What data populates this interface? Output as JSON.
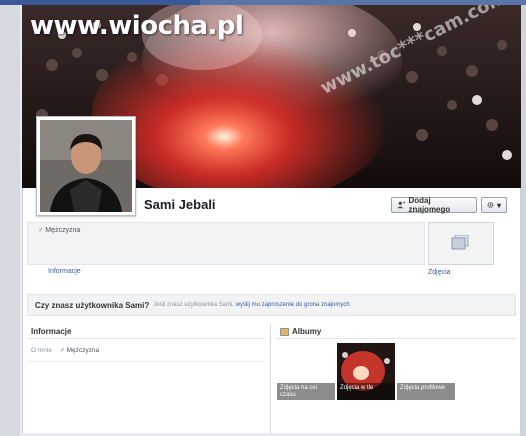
{
  "watermark": "www.wiocha.pl",
  "cover_watermark": "www.toc***cam.com",
  "profile": {
    "name": "Sami Jebali",
    "gender": "Mężczyzna"
  },
  "actions": {
    "add_friend": "Dodaj znajomego",
    "gear_caret": "▾"
  },
  "links": {
    "info": "Informacje",
    "photos": "Zdjęcia"
  },
  "know_bar": {
    "question": "Czy znasz użytkownika Sami?",
    "prefix": "Jeśli znasz użytkownika Sami,",
    "link": "wyślij mu zaproszenie do grona znajomych",
    "suffix": "."
  },
  "about": {
    "heading": "Informacje",
    "key": "O mnie",
    "gender": "Mężczyzna"
  },
  "albums": {
    "heading": "Albumy",
    "items": [
      {
        "label": "Zdjęcia na osi czasu"
      },
      {
        "label": "Zdjęcia w tle"
      },
      {
        "label": "Zdjęcia profilowe"
      }
    ]
  },
  "colors": {
    "brand": "#3b5998",
    "link": "#3b5998",
    "flare": "#ff3a2a"
  }
}
